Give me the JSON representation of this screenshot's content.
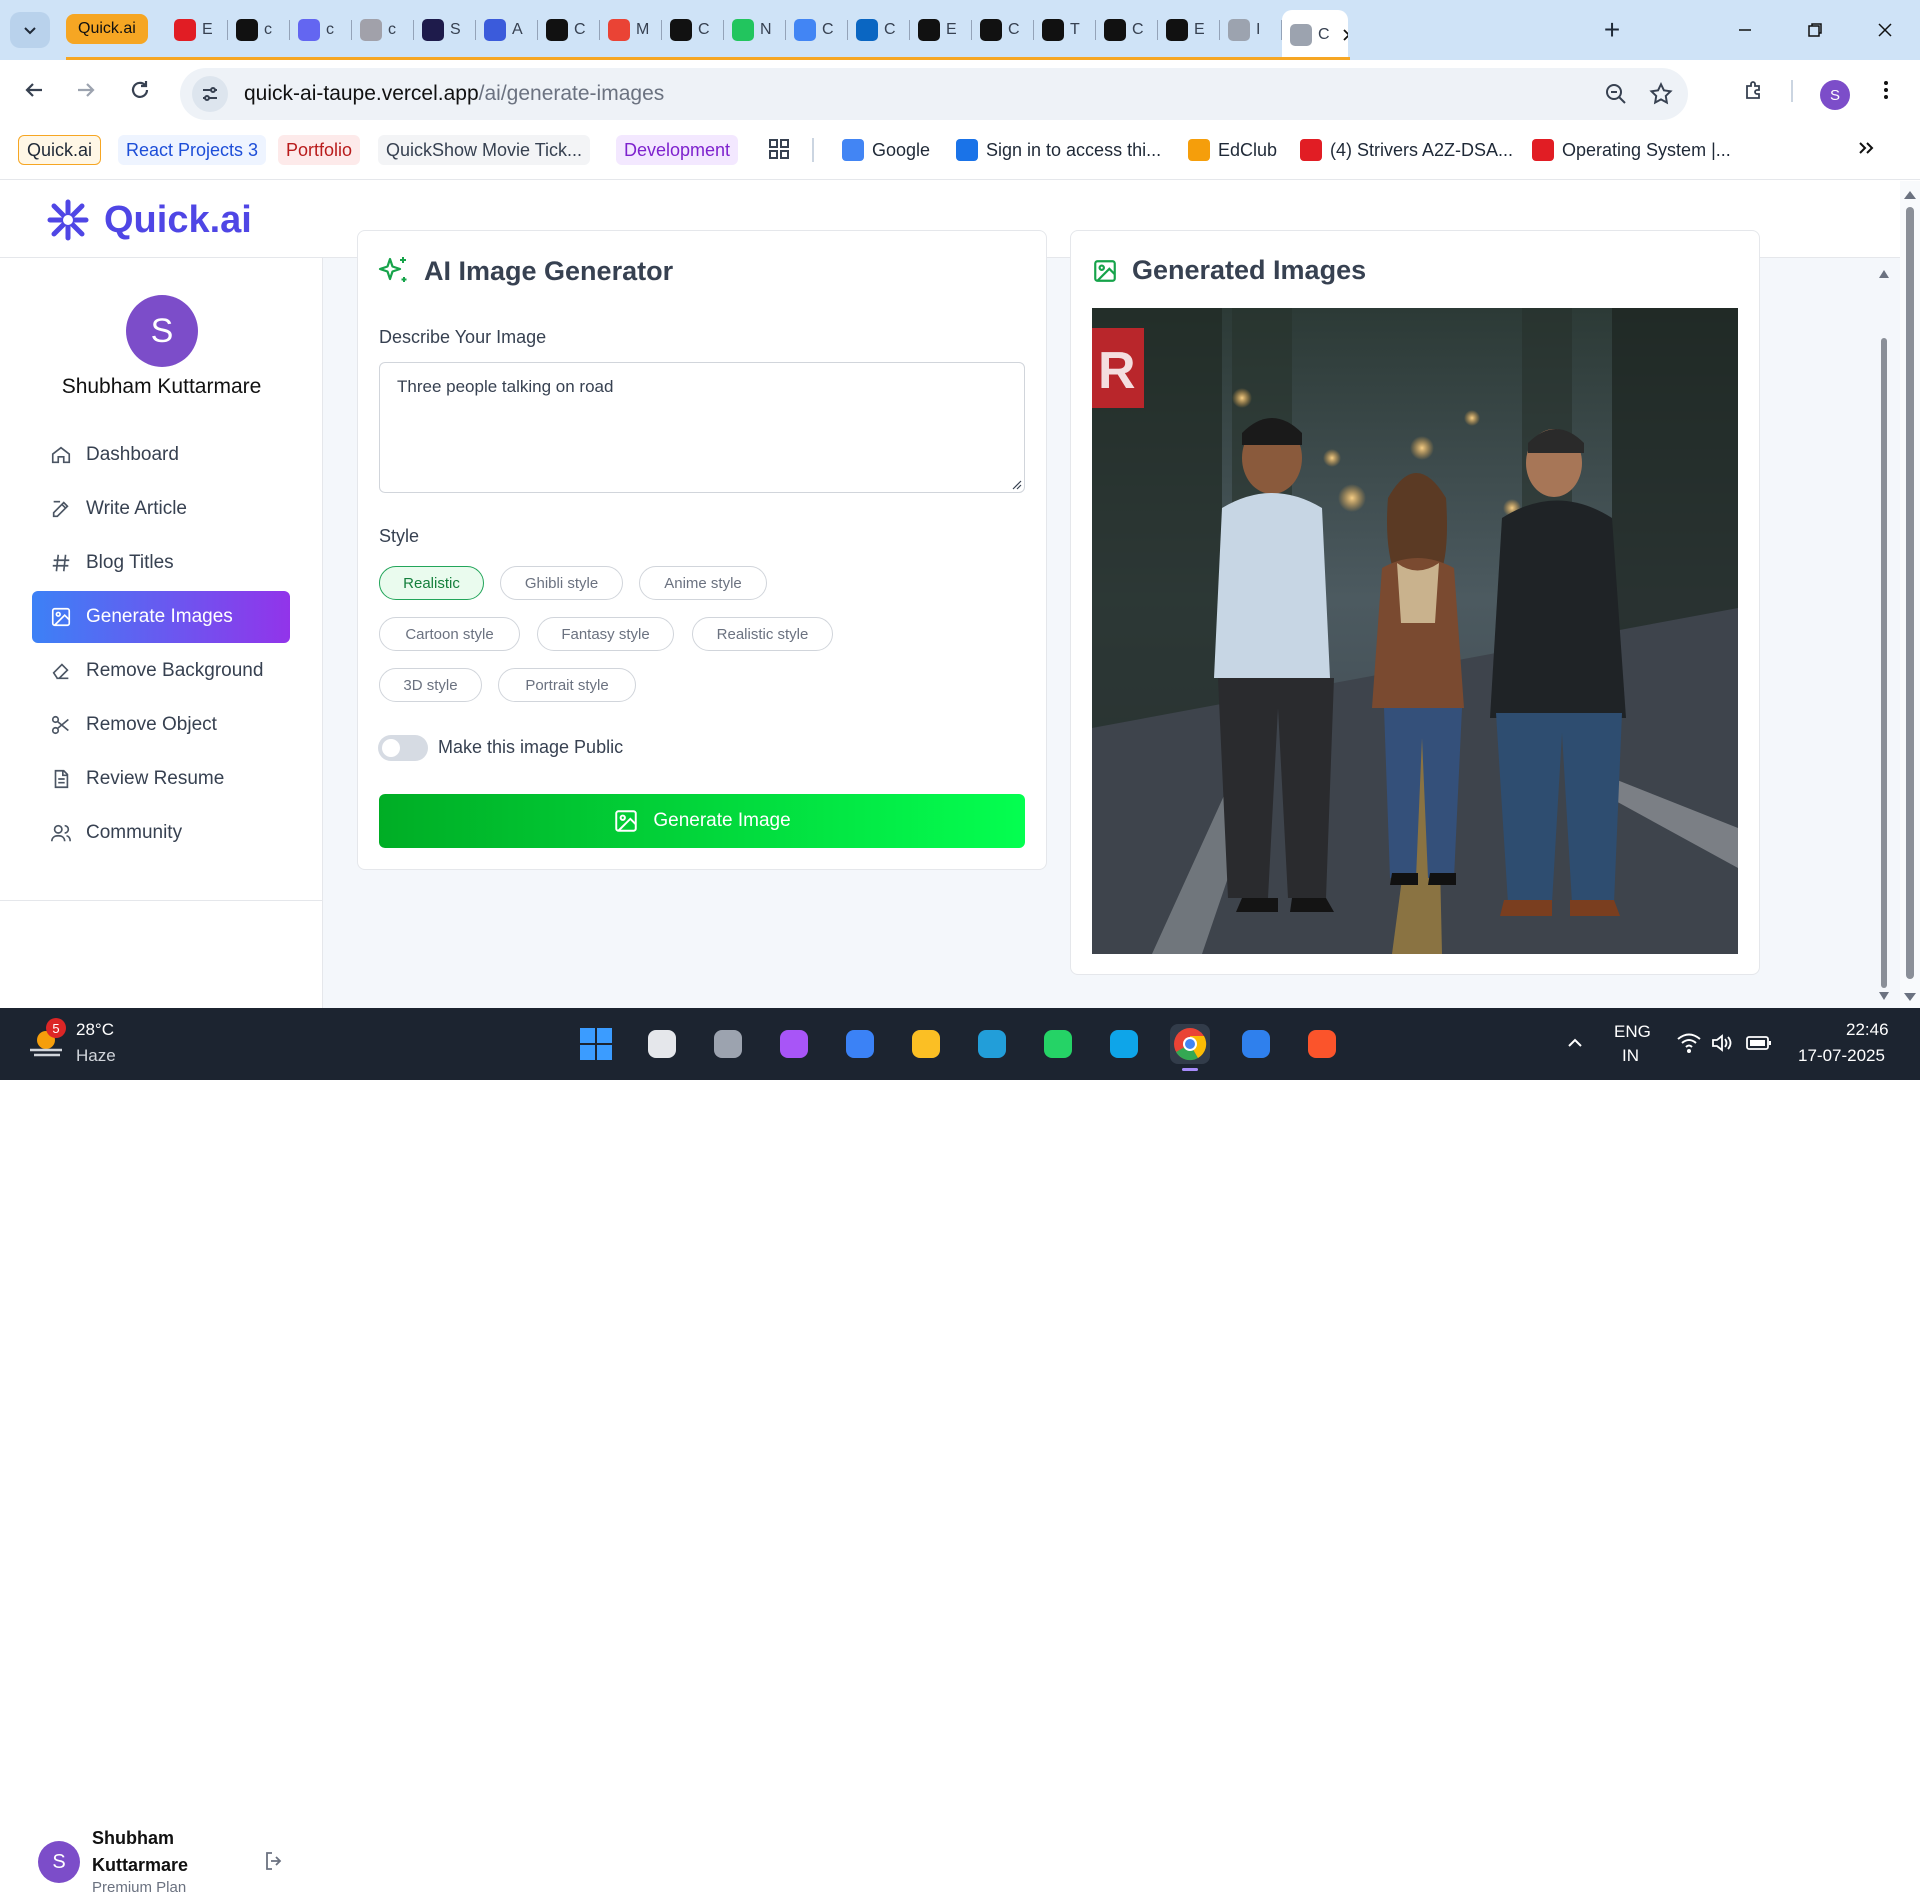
{
  "browser": {
    "tabs": [
      {
        "label": "Quick.ai",
        "icon": "quickai-tab",
        "color": "#f6a623"
      },
      {
        "label": "E",
        "icon": "youtube-icon",
        "color": "#e11d24"
      },
      {
        "label": "c",
        "icon": "a-logo-icon",
        "color": "#111111"
      },
      {
        "label": "c",
        "icon": "star-burst-icon",
        "color": "#6366f1"
      },
      {
        "label": "c",
        "icon": "palette-icon",
        "color": "#a1a1aa"
      },
      {
        "label": "S",
        "icon": "circle-s-icon",
        "color": "#1e1b4b"
      },
      {
        "label": "A",
        "icon": "chart-icon",
        "color": "#3b5bdb"
      },
      {
        "label": "C",
        "icon": "bracket-icon",
        "color": "#111111"
      },
      {
        "label": "M",
        "icon": "gmail-icon",
        "color": "#ea4335"
      },
      {
        "label": "C",
        "icon": "bracket-icon",
        "color": "#111111"
      },
      {
        "label": "N",
        "icon": "n-logo-icon",
        "color": "#22c55e"
      },
      {
        "label": "C",
        "icon": "google-icon",
        "color": "#4285f4"
      },
      {
        "label": "C",
        "icon": "butterfly-icon",
        "color": "#0a66c2"
      },
      {
        "label": "E",
        "icon": "circle-e-icon",
        "color": "#111111"
      },
      {
        "label": "C",
        "icon": "n-box-icon",
        "color": "#111111"
      },
      {
        "label": "T",
        "icon": "cube-icon",
        "color": "#111111"
      },
      {
        "label": "C",
        "icon": "circle-c-icon",
        "color": "#111111"
      },
      {
        "label": "E",
        "icon": "github-icon",
        "color": "#111111"
      },
      {
        "label": "I",
        "icon": "openai-icon",
        "color": "#9ca3af"
      },
      {
        "label": "C",
        "icon": "active-tab",
        "color": "#9ca3af"
      }
    ],
    "new_tab_label": "+",
    "url_host": "quick-ai-taupe.vercel.app",
    "url_path": "/ai/generate-images",
    "profile_initial": "S",
    "bookmarks": [
      {
        "label": "Quick.ai",
        "style": "tag",
        "bg": "#fff7e6",
        "border": "#f6a623"
      },
      {
        "label": "React Projects 3",
        "style": "tag",
        "bg": "#eef4ff",
        "color": "#1d4ed8"
      },
      {
        "label": "Portfolio",
        "style": "tag",
        "bg": "#fdeaea",
        "color": "#b91c1c"
      },
      {
        "label": "QuickShow Movie Tick...",
        "style": "tag",
        "bg": "#f3f4f6",
        "color": "#374151"
      },
      {
        "label": "Development",
        "style": "tag",
        "bg": "#f3e8ff",
        "color": "#7e22ce"
      },
      {
        "label": "Google",
        "icon": "google-icon",
        "iconcolor": "#4285f4"
      },
      {
        "label": "Sign in to access thi...",
        "icon": "s-box-icon",
        "iconcolor": "#1a73e8"
      },
      {
        "label": "EdClub",
        "icon": "edclub-icon",
        "iconcolor": "#f59e0b"
      },
      {
        "label": "(4) Strivers A2Z-DSA...",
        "icon": "youtube-icon",
        "iconcolor": "#e11d24"
      },
      {
        "label": "Operating System |...",
        "icon": "youtube-icon",
        "iconcolor": "#e11d24"
      }
    ]
  },
  "app": {
    "logo_text": "Quick.ai",
    "brand_color": "#4f46e5",
    "user_initial": "S",
    "user_name": "Shubham Kuttarmare",
    "nav": [
      {
        "label": "Dashboard",
        "icon": "home-icon"
      },
      {
        "label": "Write Article",
        "icon": "edit-icon"
      },
      {
        "label": "Blog Titles",
        "icon": "hash-icon"
      },
      {
        "label": "Generate Images",
        "icon": "image-icon",
        "active": true
      },
      {
        "label": "Remove Background",
        "icon": "eraser-icon"
      },
      {
        "label": "Remove Object",
        "icon": "scissors-icon"
      },
      {
        "label": "Review Resume",
        "icon": "file-icon"
      },
      {
        "label": "Community",
        "icon": "users-icon"
      }
    ],
    "footer": {
      "name": "Shubham Kuttarmare",
      "plan": "Premium Plan",
      "initial": "S"
    }
  },
  "generator": {
    "title": "AI Image Generator",
    "describe_label": "Describe Your Image",
    "prompt_value": "Three people talking on road",
    "style_label": "Style",
    "styles": [
      "Realistic",
      "Ghibli style",
      "Anime style",
      "Cartoon style",
      "Fantasy style",
      "Realistic style",
      "3D style",
      "Portrait style"
    ],
    "selected_style": "Realistic",
    "public_label": "Make this image Public",
    "public_on": false,
    "button_label": "Generate Image"
  },
  "output": {
    "title": "Generated Images",
    "accent": "#16a34a"
  },
  "taskbar": {
    "weather_temp": "28°C",
    "weather_desc": "Haze",
    "weather_badge": "5",
    "lang_top": "ENG",
    "lang_bottom": "IN",
    "time": "22:46",
    "date": "17-07-2025",
    "apps": [
      "windows-start-icon",
      "task-view-icon",
      "clock-app-icon",
      "copilot-icon",
      "todo-icon",
      "file-explorer-icon",
      "telegram-icon",
      "whatsapp-icon",
      "edge-icon",
      "chrome-icon",
      "vscode-icon",
      "brave-icon"
    ]
  }
}
